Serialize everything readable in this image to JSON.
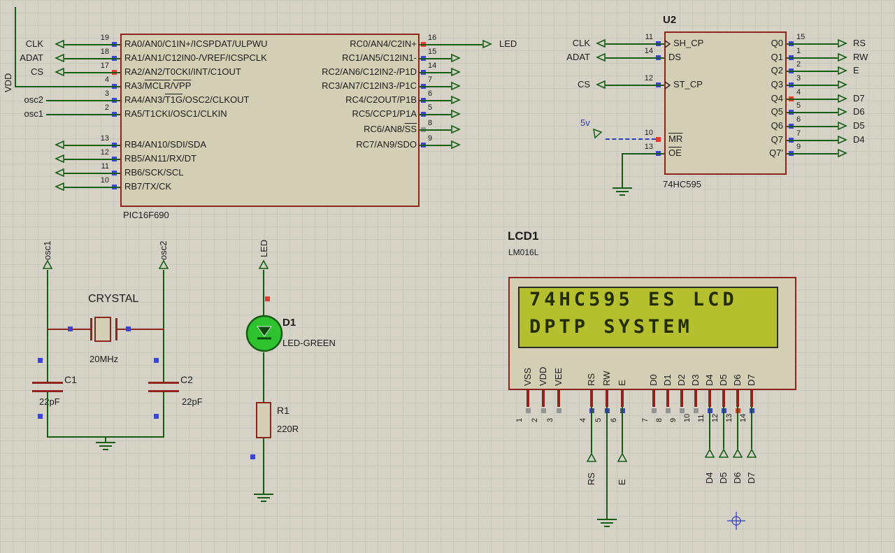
{
  "colors": {
    "background": "#d6d2c6",
    "grid_line": "#c7c9c0",
    "wire": "#155c15",
    "chip_fill": "#d3cfb4",
    "chip_border": "#8e241c",
    "pin_text": "#1b1b1b",
    "state_high": "#e23c30",
    "state_low": "#3d44cf",
    "state_float": "#919691",
    "lcd_screen_fill": "#b5c02e",
    "lcd_screen_border": "#2b2b2b",
    "lcd_text_color": "#232d00",
    "power_label_color": "#2d3bbd"
  },
  "pic": {
    "ref": "PIC16F690",
    "left_pins": [
      {
        "num": "19",
        "name": "RA0/AN0/C1IN+/ICSPDAT/ULPWU",
        "state": "low",
        "terminal": "CLK"
      },
      {
        "num": "18",
        "name": "RA1/AN1/C12IN0-/VREF/ICSPCLK",
        "state": "low",
        "terminal": "ADAT"
      },
      {
        "num": "17",
        "name": "RA2/AN2/T0CKI/INT/C1OUT",
        "state": "high",
        "terminal": "CS"
      },
      {
        "num": "4",
        "name": "RA3/MCLR/VPP",
        "state": "low",
        "terminal": "VDD",
        "ov": [
          "MCLR",
          "VPP"
        ]
      },
      {
        "num": "3",
        "name": "RA4/AN3/T1G/OSC2/CLKOUT",
        "state": "low",
        "terminal": "osc2",
        "ov": [
          "T1G"
        ]
      },
      {
        "num": "2",
        "name": "RA5/T1CKI/OSC1/CLKIN",
        "state": "low",
        "terminal": "osc1"
      },
      {
        "num": "13",
        "name": "RB4/AN10/SDI/SDA",
        "state": "low",
        "terminal": ""
      },
      {
        "num": "12",
        "name": "RB5/AN11/RX/DT",
        "state": "low",
        "terminal": ""
      },
      {
        "num": "11",
        "name": "RB6/SCK/SCL",
        "state": "low",
        "terminal": ""
      },
      {
        "num": "10",
        "name": "RB7/TX/CK",
        "state": "low",
        "terminal": ""
      }
    ],
    "right_pins": [
      {
        "num": "16",
        "name": "RC0/AN4/C2IN+",
        "state": "high",
        "terminal": "LED"
      },
      {
        "num": "15",
        "name": "RC1/AN5/C12IN1-",
        "state": "low",
        "terminal": ""
      },
      {
        "num": "14",
        "name": "RC2/AN6/C12IN2-/P1D",
        "state": "low",
        "terminal": ""
      },
      {
        "num": "7",
        "name": "RC3/AN7/C12IN3-/P1C",
        "state": "low",
        "terminal": ""
      },
      {
        "num": "6",
        "name": "RC4/C2OUT/P1B",
        "state": "low",
        "terminal": ""
      },
      {
        "num": "5",
        "name": "RC5/CCP1/P1A",
        "state": "low",
        "terminal": ""
      },
      {
        "num": "8",
        "name": "RC6/AN8/SS",
        "state": "float",
        "terminal": "",
        "ov": [
          "SS"
        ]
      },
      {
        "num": "9",
        "name": "RC7/AN9/SDO",
        "state": "low",
        "terminal": ""
      }
    ]
  },
  "u2": {
    "designator": "U2",
    "part": "74HC595",
    "left_pins": [
      {
        "num": "11",
        "name": "SH_CP",
        "state": "low",
        "terminal": "CLK",
        "clock": true
      },
      {
        "num": "14",
        "name": "DS",
        "state": "low",
        "terminal": "ADAT"
      },
      {
        "num": "12",
        "name": "ST_CP",
        "state": "low",
        "terminal": "CS",
        "clock": true
      },
      {
        "num": "10",
        "name": "MR",
        "state": "high",
        "terminal": "5v",
        "ov": [
          "MR"
        ],
        "power": true
      },
      {
        "num": "13",
        "name": "OE",
        "state": "low",
        "terminal": "",
        "ov": [
          "OE"
        ],
        "ground": true
      }
    ],
    "right_pins": [
      {
        "num": "15",
        "name": "Q0",
        "state": "low",
        "terminal": "RS"
      },
      {
        "num": "1",
        "name": "Q1",
        "state": "low",
        "terminal": "RW"
      },
      {
        "num": "2",
        "name": "Q2",
        "state": "low",
        "terminal": "E"
      },
      {
        "num": "3",
        "name": "Q3",
        "state": "low",
        "terminal": ""
      },
      {
        "num": "4",
        "name": "Q4",
        "state": "high",
        "terminal": "D7"
      },
      {
        "num": "5",
        "name": "Q5",
        "state": "low",
        "terminal": "D6"
      },
      {
        "num": "6",
        "name": "Q6",
        "state": "low",
        "terminal": "D5"
      },
      {
        "num": "7",
        "name": "Q7",
        "state": "low",
        "terminal": "D4"
      },
      {
        "num": "9",
        "name": "Q7'",
        "state": "low",
        "terminal": ""
      }
    ]
  },
  "lcd": {
    "designator": "LCD1",
    "part": "LM016L",
    "line1": "74HC595 ES LCD",
    "line2": "DPTP SYSTEM",
    "pins": [
      {
        "num": "1",
        "name": "VSS",
        "state": "float"
      },
      {
        "num": "2",
        "name": "VDD",
        "state": "float"
      },
      {
        "num": "3",
        "name": "VEE",
        "state": "float"
      },
      {
        "num": "4",
        "name": "RS",
        "state": "low",
        "terminal": "RS"
      },
      {
        "num": "5",
        "name": "RW",
        "state": "low",
        "ground": true
      },
      {
        "num": "6",
        "name": "E",
        "state": "low",
        "terminal": "E"
      },
      {
        "num": "7",
        "name": "D0",
        "state": "float"
      },
      {
        "num": "8",
        "name": "D1",
        "state": "float"
      },
      {
        "num": "9",
        "name": "D2",
        "state": "float"
      },
      {
        "num": "10",
        "name": "D3",
        "state": "float"
      },
      {
        "num": "11",
        "name": "D4",
        "state": "low",
        "terminal": "D4"
      },
      {
        "num": "12",
        "name": "D5",
        "state": "low",
        "terminal": "D5"
      },
      {
        "num": "13",
        "name": "D6",
        "state": "high",
        "terminal": "D6"
      },
      {
        "num": "14",
        "name": "D7",
        "state": "low",
        "terminal": "D7"
      }
    ]
  },
  "crystal": {
    "label": "CRYSTAL",
    "freq": "20MHz",
    "osc1": "osc1",
    "osc2": "osc2",
    "c1_ref": "C1",
    "c1_val": "22pF",
    "c2_ref": "C2",
    "c2_val": "22pF"
  },
  "led_circuit": {
    "terminal": "LED",
    "d1_ref": "D1",
    "d1_val": "LED-GREEN",
    "r1_ref": "R1",
    "r1_val": "220R"
  },
  "power": {
    "vdd": "VDD",
    "v5": "5v"
  }
}
